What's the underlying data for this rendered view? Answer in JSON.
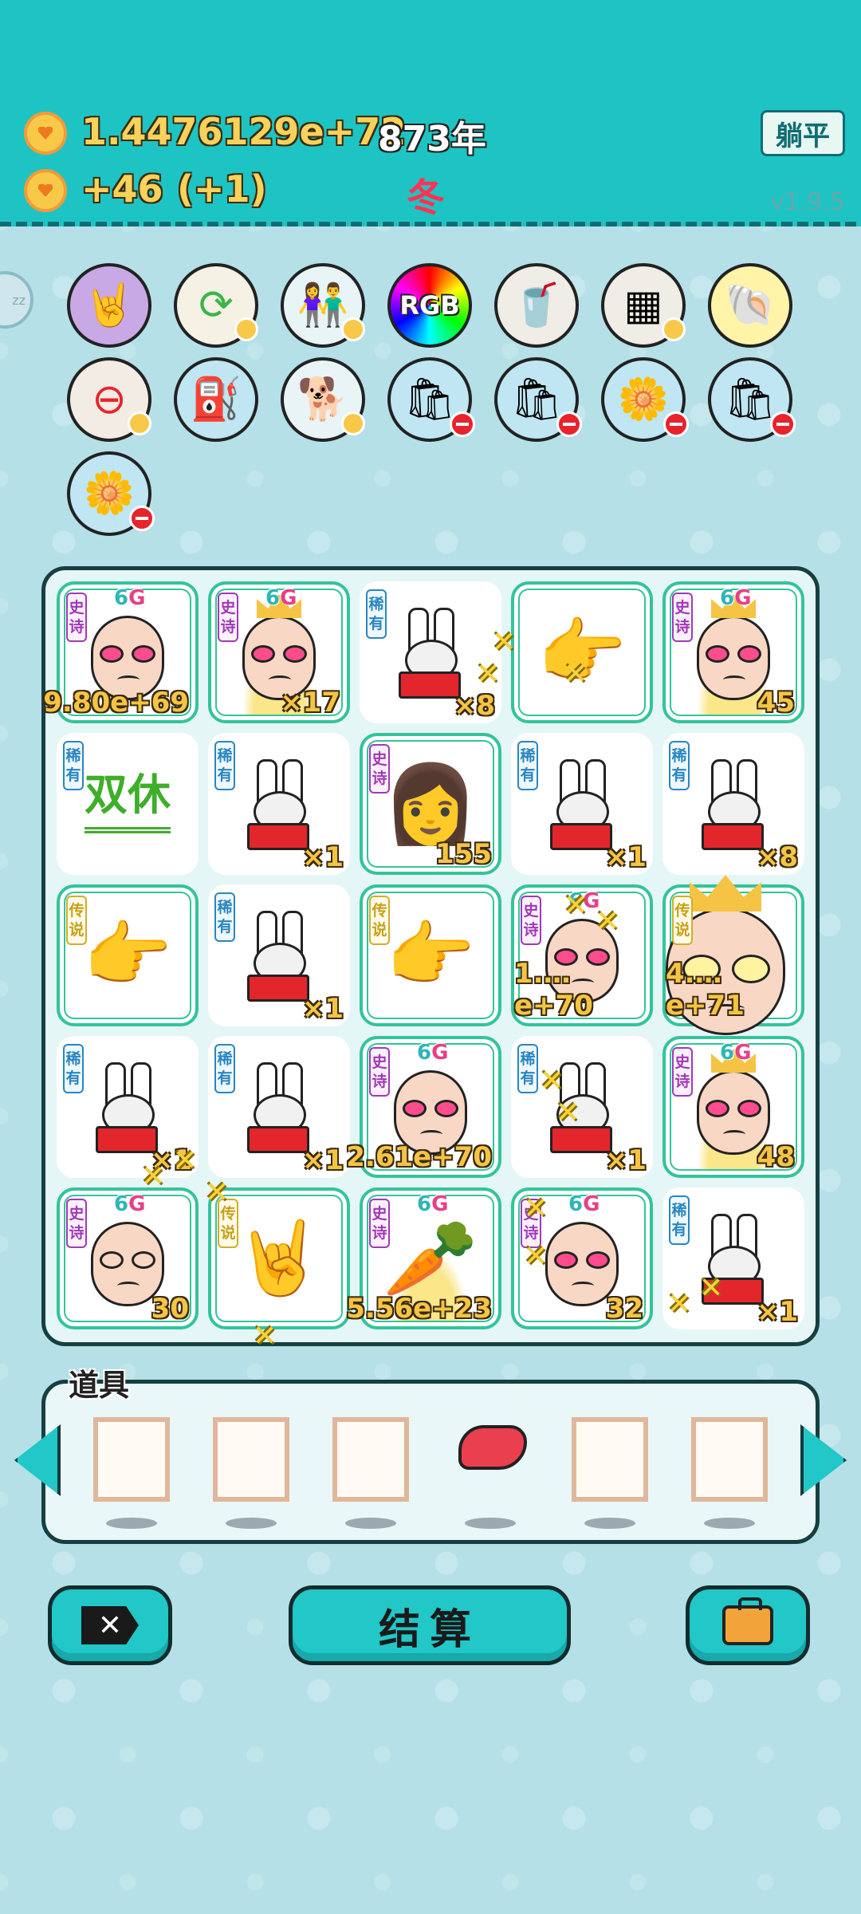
{
  "header": {
    "gold_total": "1.4476129e+72",
    "year": "873年",
    "gold_rate": "+46",
    "gold_rate_extra": "(+1)",
    "season": "冬",
    "lie_flat_button": "躺平",
    "version": "v1.9.5",
    "sleep_badge": "zz"
  },
  "colors": {
    "header_bg": "#1ec4c4",
    "page_bg": "#b5e0e8",
    "gold": "#f8d25a",
    "season_red": "#ff3355",
    "button_teal": "#22c7c8"
  },
  "skill_icons": [
    {
      "name": "rock-hand-icon",
      "badge": "none"
    },
    {
      "name": "refresh-icon",
      "badge": "heart"
    },
    {
      "name": "couple-icon",
      "badge": "heart"
    },
    {
      "name": "rgb-icon",
      "label": "RGB",
      "badge": "none"
    },
    {
      "name": "milk-tea-icon",
      "badge": "none"
    },
    {
      "name": "sugar-cubes-icon",
      "badge": "heart"
    },
    {
      "name": "shell-icon",
      "badge": "none"
    },
    {
      "name": "no-entry-icon",
      "badge": "heart"
    },
    {
      "name": "pump-icon",
      "badge": "none"
    },
    {
      "name": "husky-icon",
      "badge": "heart"
    },
    {
      "name": "sack-icon",
      "badge": "minus"
    },
    {
      "name": "sack-icon",
      "badge": "minus"
    },
    {
      "name": "flower-pot-icon",
      "badge": "minus"
    },
    {
      "name": "sack-icon",
      "badge": "minus"
    },
    {
      "name": "flower-pot-icon",
      "badge": "minus"
    }
  ],
  "board": {
    "rows": [
      [
        {
          "rarity": "史诗",
          "type": "epic",
          "g6": true,
          "char": "bald-face",
          "count": "9.80e+69"
        },
        {
          "rarity": "史诗",
          "type": "epic",
          "g6": true,
          "char": "bald-face-crown",
          "count": "×17"
        },
        {
          "rarity": "稀有",
          "type": "rare",
          "g6": false,
          "char": "bunny",
          "count": "×8"
        },
        {
          "rarity": "",
          "type": "none",
          "g6": false,
          "char": "pointing-hand",
          "count": ""
        },
        {
          "rarity": "史诗",
          "type": "epic",
          "g6": true,
          "char": "bald-face-crown",
          "count": "45"
        }
      ],
      [
        {
          "rarity": "稀有",
          "type": "rare",
          "g6": false,
          "char": "weekend-text",
          "label": "双休",
          "count": ""
        },
        {
          "rarity": "稀有",
          "type": "rare",
          "g6": false,
          "char": "bunny",
          "count": "×1"
        },
        {
          "rarity": "史诗",
          "type": "epic",
          "g6": false,
          "char": "girl",
          "count": "155"
        },
        {
          "rarity": "稀有",
          "type": "rare",
          "g6": false,
          "char": "bunny",
          "count": "×1"
        },
        {
          "rarity": "稀有",
          "type": "rare",
          "g6": false,
          "char": "bunny",
          "count": "×8"
        }
      ],
      [
        {
          "rarity": "传说",
          "type": "legend",
          "g6": false,
          "char": "pointing-hand",
          "count": ""
        },
        {
          "rarity": "稀有",
          "type": "rare",
          "g6": false,
          "char": "bunny",
          "count": "×1"
        },
        {
          "rarity": "传说",
          "type": "legend",
          "g6": false,
          "char": "pointing-hand",
          "count": ""
        },
        {
          "rarity": "史诗",
          "type": "epic",
          "g6": true,
          "char": "bald-face",
          "count": "1.…e+70"
        },
        {
          "rarity": "传说",
          "type": "legend",
          "g6": false,
          "char": "big-king",
          "count": "4.…e+71"
        }
      ],
      [
        {
          "rarity": "稀有",
          "type": "rare",
          "g6": false,
          "char": "bunny",
          "count": "×1"
        },
        {
          "rarity": "稀有",
          "type": "rare",
          "g6": false,
          "char": "bunny",
          "count": "×1"
        },
        {
          "rarity": "史诗",
          "type": "epic",
          "g6": true,
          "char": "bald-face",
          "count": "2.61e+70"
        },
        {
          "rarity": "稀有",
          "type": "rare",
          "g6": false,
          "char": "bunny",
          "count": "×1"
        },
        {
          "rarity": "史诗",
          "type": "epic",
          "g6": true,
          "char": "bald-face-crown",
          "count": "48"
        }
      ],
      [
        {
          "rarity": "史诗",
          "type": "epic",
          "g6": true,
          "char": "glasses-face",
          "count": "30"
        },
        {
          "rarity": "传说",
          "type": "legend",
          "g6": false,
          "char": "rock-hand",
          "count": ""
        },
        {
          "rarity": "史诗",
          "type": "epic",
          "g6": true,
          "char": "carrot",
          "count": "5.56e+23"
        },
        {
          "rarity": "史诗",
          "type": "epic",
          "g6": true,
          "char": "bald-face",
          "count": "32"
        },
        {
          "rarity": "稀有",
          "type": "rare",
          "g6": false,
          "char": "bunny",
          "count": "×1"
        }
      ]
    ]
  },
  "props": {
    "title": "道具",
    "slots": [
      "empty",
      "empty",
      "empty",
      "liver",
      "empty",
      "empty"
    ]
  },
  "buttons": {
    "settle_label": "结算",
    "close_label": "✕"
  }
}
